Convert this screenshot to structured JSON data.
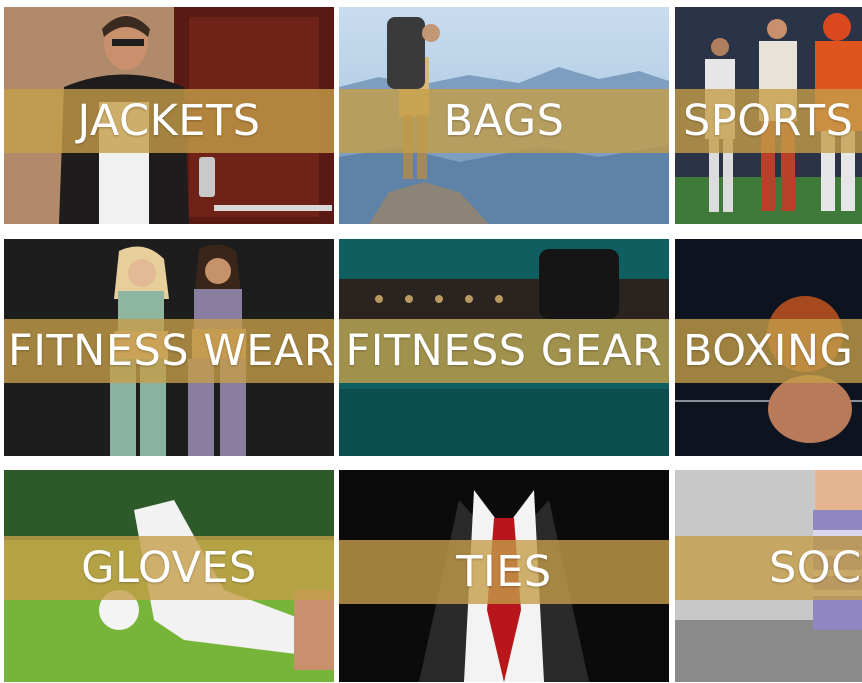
{
  "categories": [
    {
      "id": "jackets",
      "label": "JACKETS"
    },
    {
      "id": "bags",
      "label": "BAGS"
    },
    {
      "id": "sports",
      "label": "SPORTS"
    },
    {
      "id": "fitness-wear",
      "label": "FITNESS WEAR"
    },
    {
      "id": "fitness-gear",
      "label": "FITNESS GEAR"
    },
    {
      "id": "boxing",
      "label": "BOXING"
    },
    {
      "id": "gloves",
      "label": "GLOVES"
    },
    {
      "id": "ties",
      "label": "TIES"
    },
    {
      "id": "socks",
      "label": "SOC"
    }
  ],
  "colors": {
    "band": "#c49e48",
    "label_text": "#ffffff"
  }
}
